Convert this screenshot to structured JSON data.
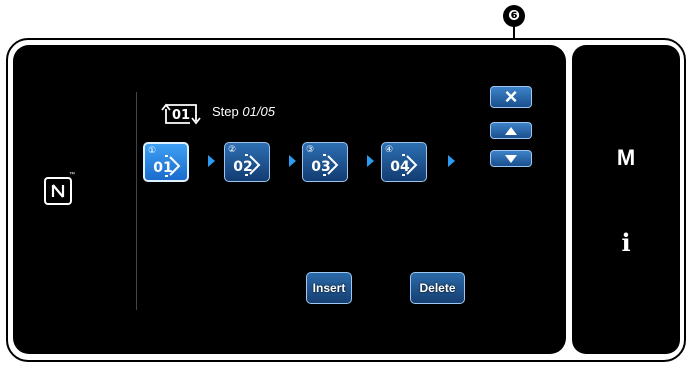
{
  "annotation": {
    "callout": "❻"
  },
  "nfc": {
    "icon": "nfc-icon",
    "tm": "™"
  },
  "step": {
    "label": "Step",
    "current": "01",
    "separator": "/",
    "total": "05",
    "icon": "step-cycle-icon",
    "icon_text": "01"
  },
  "steps": [
    {
      "marker": "①",
      "number": "01",
      "active": true
    },
    {
      "marker": "②",
      "number": "02",
      "active": false
    },
    {
      "marker": "③",
      "number": "03",
      "active": false
    },
    {
      "marker": "④",
      "number": "04",
      "active": false
    }
  ],
  "buttons": {
    "close": "×",
    "up_icon": "triangle-up-icon",
    "down_icon": "triangle-down-icon",
    "insert": "Insert",
    "delete": "Delete"
  },
  "side": {
    "mode": "M",
    "info": "i"
  },
  "colors": {
    "accent": "#2d9cf0",
    "button_dark": "#123c72",
    "button_light": "#3fa0f4",
    "panel": "#000000",
    "callout_dot": "#c1122a"
  }
}
